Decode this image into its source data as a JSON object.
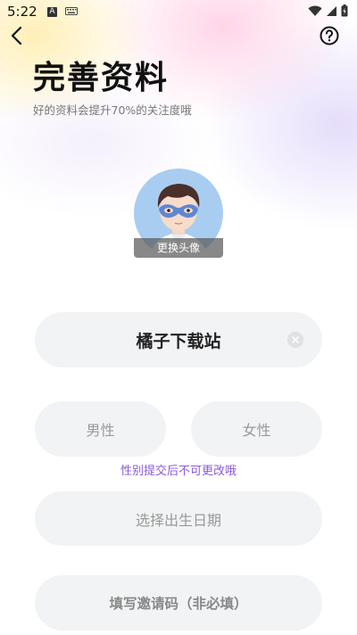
{
  "status_bar": {
    "time": "5:22",
    "a_badge": "A"
  },
  "header": {
    "title": "完善资料",
    "subtitle": "好的资料会提升70%的关注度哦"
  },
  "avatar": {
    "caption": "更换头像"
  },
  "form": {
    "nickname_value": "橘子下载站",
    "gender_male": "男性",
    "gender_female": "女性",
    "gender_note": "性别提交后不可更改哦",
    "birthdate_placeholder": "选择出生日期",
    "invite_placeholder": "填写邀请码（非必填）"
  },
  "icons": {
    "back": "back-arrow-icon",
    "help": "help-circle-icon",
    "clear": "clear-icon",
    "wifi": "wifi-icon",
    "signal": "signal-icon",
    "battery": "battery-icon",
    "keyboard": "keyboard-icon"
  },
  "colors": {
    "accent_note": "#8a5bd6",
    "field_bg": "#f2f3f5",
    "avatar_bg": "#a9cdf0"
  }
}
